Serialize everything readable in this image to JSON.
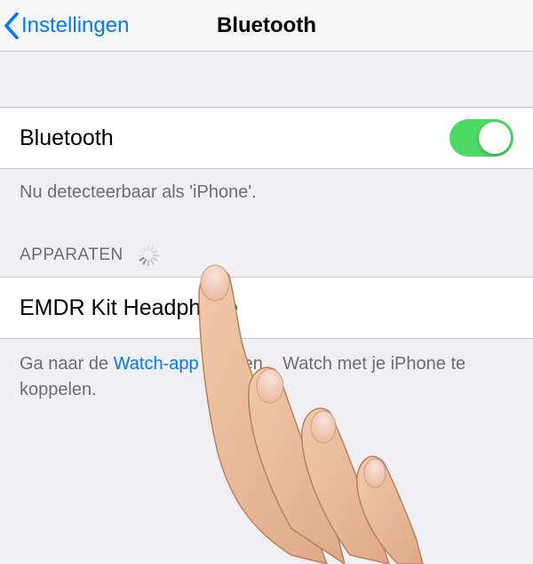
{
  "navbar": {
    "back_label": "Instellingen",
    "title": "Bluetooth"
  },
  "bluetooth_row": {
    "label": "Bluetooth",
    "toggle_on": true
  },
  "discoverable_caption": "Nu detecteerbaar als 'iPhone'.",
  "devices_header": "APPARATEN",
  "devices": [
    {
      "name": "EMDR Kit Headphone"
    }
  ],
  "footer": {
    "pre": "Ga naar de ",
    "link": "Watch-app",
    "mid": " om een ",
    "obscured": "e",
    "post": " Watch met je iPhone te koppelen."
  }
}
